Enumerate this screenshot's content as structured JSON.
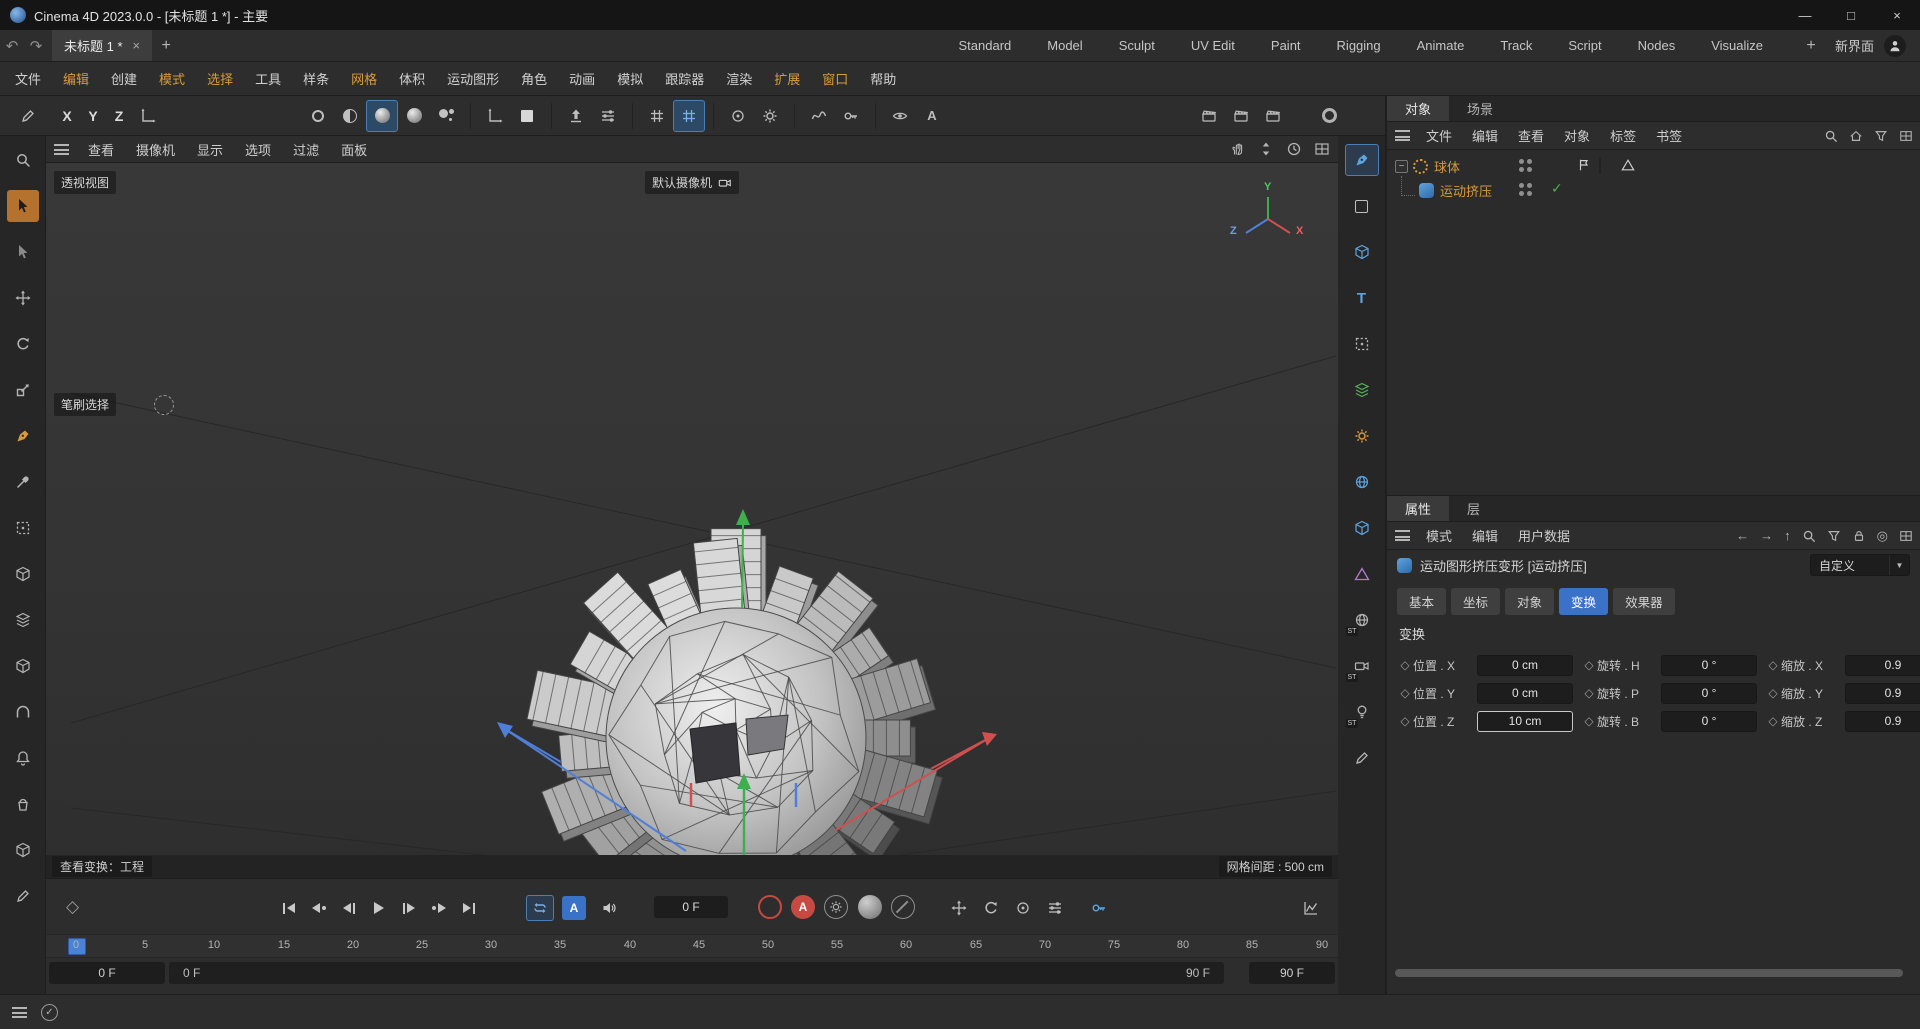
{
  "titlebar": {
    "title": "Cinema 4D 2023.0.0 - [未标题 1 *] - 主要",
    "minimize": "—",
    "maximize": "□",
    "close": "×"
  },
  "tabbar": {
    "undo": "↶",
    "redo": "↷",
    "tab_label": "未标题 1 *",
    "tab_close": "×",
    "add_tab": "+",
    "layouts": [
      "Standard",
      "Model",
      "Sculpt",
      "UV Edit",
      "Paint",
      "Rigging",
      "Animate",
      "Track",
      "Script",
      "Nodes",
      "Visualize"
    ],
    "add_layout": "+",
    "new_interface": "新界面"
  },
  "menubar": {
    "items": [
      {
        "label": "文件",
        "hl": false
      },
      {
        "label": "编辑",
        "hl": true
      },
      {
        "label": "创建",
        "hl": false
      },
      {
        "label": "模式",
        "hl": true
      },
      {
        "label": "选择",
        "hl": true
      },
      {
        "label": "工具",
        "hl": false
      },
      {
        "label": "样条",
        "hl": false
      },
      {
        "label": "网格",
        "hl": true
      },
      {
        "label": "体积",
        "hl": false
      },
      {
        "label": "运动图形",
        "hl": false
      },
      {
        "label": "角色",
        "hl": false
      },
      {
        "label": "动画",
        "hl": false
      },
      {
        "label": "模拟",
        "hl": false
      },
      {
        "label": "跟踪器",
        "hl": false
      },
      {
        "label": "渲染",
        "hl": false
      },
      {
        "label": "扩展",
        "hl": true
      },
      {
        "label": "窗口",
        "hl": true
      },
      {
        "label": "帮助",
        "hl": false
      }
    ]
  },
  "toolbar": {
    "axis_x": "X",
    "axis_y": "Y",
    "axis_z": "Z",
    "annotation": "A"
  },
  "viewport": {
    "menu": [
      "查看",
      "摄像机",
      "显示",
      "选项",
      "过滤",
      "面板"
    ],
    "view_label": "透视视图",
    "camera_label": "默认摄像机",
    "brush_label": "笔刷选择",
    "status_left": "查看变换：工程",
    "status_right": "网格间距 : 500 cm",
    "axis_x": "X",
    "axis_y": "Y",
    "axis_z": "Z"
  },
  "timeline": {
    "ticks": [
      "0",
      "5",
      "10",
      "15",
      "20",
      "25",
      "30",
      "35",
      "40",
      "45",
      "50",
      "55",
      "60",
      "65",
      "70",
      "75",
      "80",
      "85",
      "90"
    ],
    "current_frame": "0 F",
    "autokey": "A",
    "record_auto": "A",
    "range_start_box": "0 F",
    "range_start": "0 F",
    "range_end": "90 F",
    "range_end_box": "90 F"
  },
  "object_manager": {
    "tab_objects": "对象",
    "tab_scene": "场景",
    "menu": [
      "文件",
      "编辑",
      "查看",
      "对象",
      "标签",
      "书签"
    ],
    "expand": "−",
    "sphere_name": "球体",
    "extrude_name": "运动挤压",
    "check": "✓"
  },
  "attributes": {
    "tab_attr": "属性",
    "tab_layer": "层",
    "menu": [
      "模式",
      "编辑",
      "用户数据"
    ],
    "object_title": "运动图形挤压变形 [运动挤压]",
    "preset": "自定义",
    "tabs": [
      "基本",
      "坐标",
      "对象",
      "变换",
      "效果器"
    ],
    "section": "变换",
    "rows": [
      {
        "pl": "位置 . X",
        "pv": "0 cm",
        "rl": "旋转 . H",
        "rv": "0 °",
        "sl": "缩放 . X",
        "sv": "0.9"
      },
      {
        "pl": "位置 . Y",
        "pv": "0 cm",
        "rl": "旋转 . P",
        "rv": "0 °",
        "sl": "缩放 . Y",
        "sv": "0.9"
      },
      {
        "pl": "位置 . Z",
        "pv": "10 cm",
        "rl": "旋转 . B",
        "rv": "0 °",
        "sl": "缩放 . Z",
        "sv": "0.9"
      }
    ]
  },
  "glyphs": {
    "diamond": "◇",
    "dd": "▼",
    "t": "T",
    "st": "ST",
    "back": "←",
    "fwd": "→",
    "up": "↑",
    "target": "◎"
  }
}
